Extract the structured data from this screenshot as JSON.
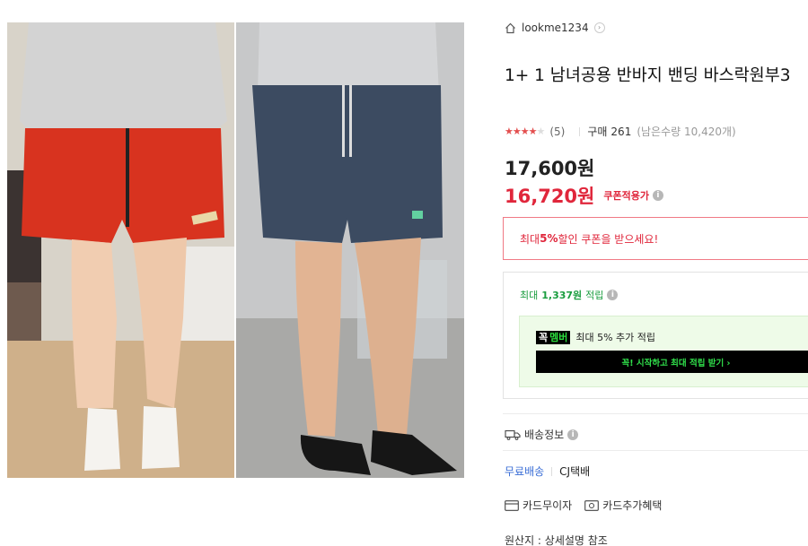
{
  "store": {
    "name": "lookme1234",
    "icon": "home-icon",
    "chevron": "›"
  },
  "product": {
    "title": "1+ 1 남녀공용 반바지 밴딩 바스락원부3",
    "rating_stars": 4.5,
    "review_count": "(5)",
    "buy_label": "구매",
    "buy_count": "261",
    "stock_text": "(남은수량 10,420개)",
    "price_original": "17,600원",
    "price_sale": "16,720원",
    "coupon_applied_label": "쿠폰적용가"
  },
  "coupon_banner": {
    "prefix": "최대 ",
    "highlight": "5%",
    "suffix": " 할인 쿠폰을 받으세요!"
  },
  "points": {
    "prefix": "최대",
    "amount": "1,337원",
    "suffix": "적립",
    "member_logo_main": "꼭",
    "member_logo_accent": "멤버",
    "member_text": "최대 5% 추가 적립",
    "member_button": "꼭! 시작하고 최대 적립 받기 ›"
  },
  "shipping": {
    "label": "배송정보",
    "free": "무료배송",
    "carrier": "CJ택배"
  },
  "cards": {
    "installment": "카드무이자",
    "benefit": "카드추가혜택"
  },
  "origin": "원산지 : 상세설명 참조",
  "colors": {
    "accent_red": "#e0263b",
    "point_green": "#1a9d3f",
    "link_blue": "#3a6ed6",
    "member_green": "#2bde3d"
  }
}
